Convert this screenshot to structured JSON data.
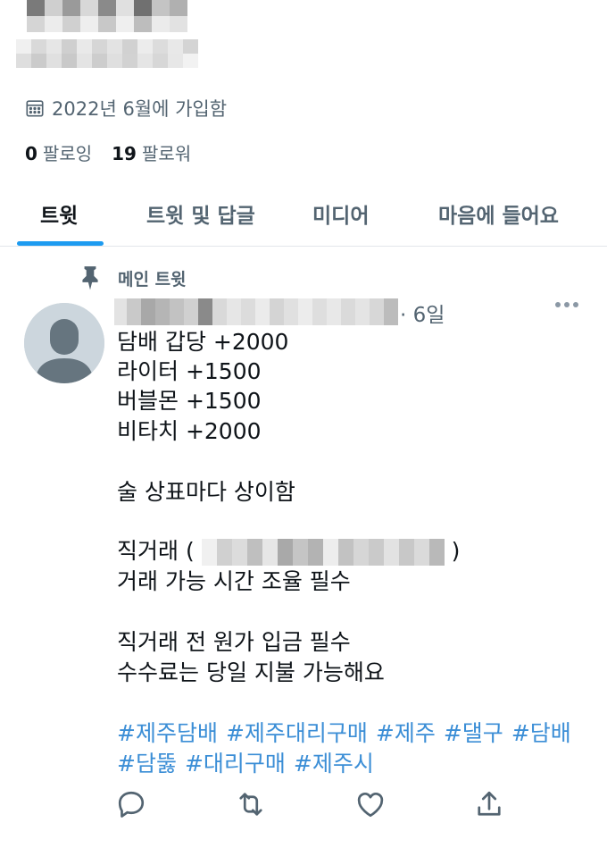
{
  "profile": {
    "joined_text": "2022년 6월에 가입함",
    "following_count": "0",
    "following_label": "팔로잉",
    "followers_count": "19",
    "followers_label": "팔로워"
  },
  "tabs": [
    {
      "label": "트윗",
      "active": true
    },
    {
      "label": "트윗 및 답글",
      "active": false
    },
    {
      "label": "미디어",
      "active": false
    },
    {
      "label": "마음에 들어요",
      "active": false
    }
  ],
  "tweet": {
    "pinned_label": "메인 트윗",
    "time": "· 6일",
    "lines": [
      "담배 갑당 +2000",
      "라이터 +1500",
      "버블몬 +1500",
      "비타치 +2000",
      "술 상표마다 상이함",
      "직거래 (",
      ")",
      "거래 가능 시간 조율 필수",
      "직거래 전 원가 입금 필수",
      "수수료는 당일 지불 가능해요"
    ],
    "hashtags": [
      "#제주담배",
      "#제주대리구매",
      "#제주",
      "#댈구",
      "#담배",
      "#담뚫",
      "#대리구매",
      "#제주시"
    ]
  },
  "colors": {
    "accent": "#1d9bf0",
    "hashtag": "#3b8ed6",
    "secondary_text": "#536471"
  },
  "icons": [
    "calendar-icon",
    "pin-icon",
    "more-icon",
    "reply-icon",
    "retweet-icon",
    "like-icon",
    "share-icon"
  ]
}
